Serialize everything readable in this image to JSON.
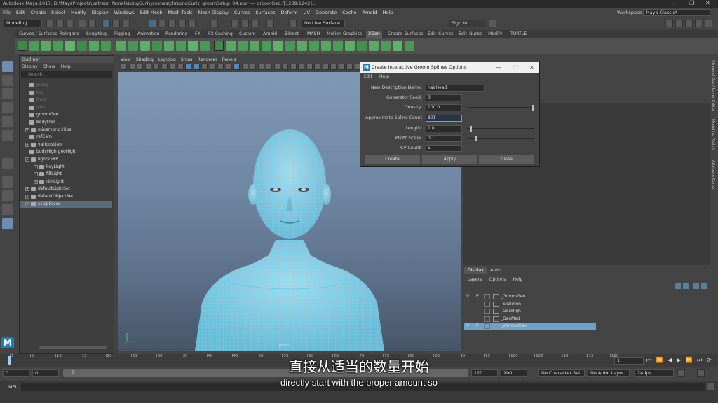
{
  "window": {
    "title": "Autodesk Maya 2017: D:\\MayaProjects\\patreon_femaleLongCurly\\scenes\\chrLongCurly_groomSetup_04.ma*  ---  groomGeo.f[1239:1242]...",
    "minimize": "—",
    "maximize": "❐",
    "close": "✕"
  },
  "menubar": {
    "items": [
      "File",
      "Edit",
      "Create",
      "Select",
      "Modify",
      "Display",
      "Windows",
      "Edit Mesh",
      "Mesh Tools",
      "Mesh Display",
      "Curves",
      "Surfaces",
      "Deform",
      "UV",
      "Generate",
      "Cache",
      "Arnold",
      "Help"
    ],
    "workspace_label": "Workspace :",
    "workspace_value": "Maya Classic*"
  },
  "statusline": {
    "mode": "Modeling",
    "live_surface": "No Live Surface",
    "sign_in": "Sign In"
  },
  "shelf": {
    "tabs": [
      "Curves / Surfaces",
      "Polygons",
      "Sculpting",
      "Rigging",
      "Animation",
      "Rendering",
      "FX",
      "FX Caching",
      "Custom",
      "Arnold",
      "Bifrost",
      "MASH",
      "Motion Graphics",
      "XGen",
      "Create_Surfaces",
      "Edit_Curves",
      "Edit_Nurbs",
      "Modify",
      "TURTLE"
    ],
    "active_tab": "XGen"
  },
  "outliner": {
    "title": "Outliner",
    "menu": [
      "Display",
      "Show",
      "Help"
    ],
    "search_placeholder": "Search...",
    "items": [
      {
        "label": "persp",
        "dim": true,
        "indent": 1
      },
      {
        "label": "top",
        "dim": true,
        "indent": 1
      },
      {
        "label": "front",
        "dim": true,
        "indent": 1
      },
      {
        "label": "side",
        "dim": true,
        "indent": 1
      },
      {
        "label": "groomGeo",
        "dim": false,
        "indent": 1
      },
      {
        "label": "bodyMed",
        "dim": false,
        "indent": 1
      },
      {
        "label": "mixamorig:Hips",
        "dim": false,
        "indent": 0,
        "expand": "+"
      },
      {
        "label": "refCam",
        "dim": false,
        "indent": 1
      },
      {
        "label": "variousGeo",
        "dim": false,
        "indent": 0,
        "expand": "+"
      },
      {
        "label": "bodyHigh:geoHigh",
        "dim": false,
        "indent": 1
      },
      {
        "label": "lightsGRP",
        "dim": false,
        "indent": 0,
        "expand": "−"
      },
      {
        "label": "keyLight",
        "dim": false,
        "indent": 2,
        "expand": "+"
      },
      {
        "label": "fillLight",
        "dim": false,
        "indent": 2,
        "expand": "+"
      },
      {
        "label": "rimLight",
        "dim": false,
        "indent": 2,
        "expand": "+"
      },
      {
        "label": "defaultLightSet",
        "dim": false,
        "indent": 0,
        "expand": "+"
      },
      {
        "label": "defaultObjectSet",
        "dim": false,
        "indent": 0,
        "expand": "+"
      },
      {
        "label": "scalpFaces",
        "dim": false,
        "indent": 0,
        "expand": "+",
        "selected": true
      }
    ]
  },
  "viewport": {
    "menu": [
      "View",
      "Shading",
      "Lighting",
      "Show",
      "Renderer",
      "Panels"
    ],
    "camera_label": "persp"
  },
  "dialog": {
    "title": "Create Interactive Groom Splines Options",
    "menu": [
      "Edit",
      "Help"
    ],
    "fields": [
      {
        "label": "New Description Name:",
        "value": "hairHead",
        "slider": false
      },
      {
        "label": "Generator Seed:",
        "value": "0",
        "slider": false
      },
      {
        "label": "Density:",
        "value": "100.0",
        "slider": true,
        "level": 1.0
      },
      {
        "label": "Approximate Spline Count",
        "value": "801",
        "slider": false,
        "highlight": true
      },
      {
        "label": "Length:",
        "value": "1.0",
        "slider": true,
        "level": 0.04
      },
      {
        "label": "Width Scale:",
        "value": "0.1",
        "slider": true,
        "level": 0.12
      },
      {
        "label": "CV Count:",
        "value": "5",
        "slider": false
      }
    ],
    "buttons": {
      "create": "Create",
      "apply": "Apply",
      "close": "Close"
    }
  },
  "right_tabs": [
    "Channel Box / Layer Editor",
    "Modeling Toolkit",
    "Attribute Editor"
  ],
  "layers": {
    "tabs": [
      "Display",
      "Anim"
    ],
    "active_tab": "Display",
    "menu": [
      "Layers",
      "Options",
      "Help"
    ],
    "rows": [
      {
        "v": "V",
        "p": "P",
        "name": "_GroomGeo",
        "selected": false
      },
      {
        "v": "",
        "p": "",
        "name": "_Skeleton",
        "selected": false
      },
      {
        "v": "",
        "p": "",
        "name": "_GeoHigh",
        "selected": false
      },
      {
        "v": "",
        "p": "",
        "name": "_GeoMed",
        "selected": false
      },
      {
        "v": "V",
        "p": "P",
        "name": "_VariousGeo",
        "selected": true
      }
    ]
  },
  "timeline": {
    "ticks": [
      "1",
      "5",
      "10",
      "15",
      "20",
      "25",
      "30",
      "35",
      "40",
      "45",
      "50",
      "55",
      "60",
      "65",
      "70",
      "75",
      "80",
      "85",
      "90",
      "95",
      "100",
      "105",
      "110",
      "115",
      "120"
    ],
    "current_frame": "1",
    "start": "0",
    "end": "120",
    "range_start": "0",
    "range_start2": "0",
    "range_end": "120",
    "anim_end": "200",
    "character_set": "No Character Set",
    "anim_layer": "No Anim Layer",
    "fps": "24 fps"
  },
  "cmdline": {
    "label": "MEL"
  },
  "subtitles": {
    "chinese": "直接从适当的数量开始",
    "english": "directly start with the proper amount so"
  },
  "colors": {
    "accent": "#69a2cc",
    "wire": "#4fe0ff",
    "maya_blue": "#1a7fb5"
  }
}
